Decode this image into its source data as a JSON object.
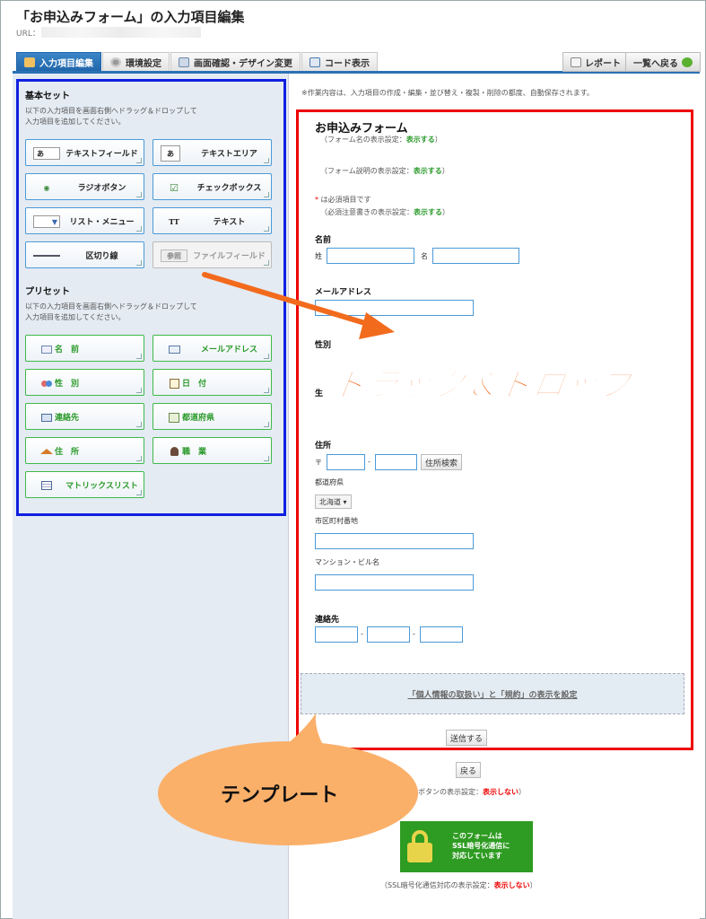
{
  "header": {
    "title": "「お申込みフォーム」の入力項目編集",
    "url_label": "URL："
  },
  "tabs": [
    {
      "label": "入力項目編集"
    },
    {
      "label": "環境設定"
    },
    {
      "label": "画面確認・デザイン変更"
    },
    {
      "label": "コード表示"
    }
  ],
  "toolbar": {
    "report": "レポート",
    "back_to_list": "一覧へ戻る"
  },
  "basic_set": {
    "title": "基本セット",
    "desc1": "以下の入力項目を画面右側へドラッグ＆ドロップして",
    "desc2": "入力項目を追加してください。",
    "items": [
      {
        "label": "テキストフィールド",
        "icon": "あ"
      },
      {
        "label": "テキストエリア",
        "icon": "あ"
      },
      {
        "label": "ラジオボタン",
        "icon": "◉"
      },
      {
        "label": "チェックボックス",
        "icon": "☑"
      },
      {
        "label": "リスト・メニュー",
        "icon": "▼"
      },
      {
        "label": "テキスト",
        "icon": "TT"
      },
      {
        "label": "区切り線",
        "icon": "—"
      },
      {
        "label": "ファイルフィールド",
        "icon": "参照"
      }
    ]
  },
  "preset": {
    "title": "プリセット",
    "desc1": "以下の入力項目を画面右側へドラッグ＆ドロップして",
    "desc2": "入力項目を追加してください。",
    "items": [
      {
        "label": "名　前"
      },
      {
        "label": "メールアドレス"
      },
      {
        "label": "性　別"
      },
      {
        "label": "日　付"
      },
      {
        "label": "連絡先"
      },
      {
        "label": "都道府県"
      },
      {
        "label": "住　所"
      },
      {
        "label": "職　業"
      },
      {
        "label": "マトリックスリスト"
      }
    ]
  },
  "autosave_note": "※作業内容は、入力項目の作成・編集・並び替え・複製・削除の都度、自動保存されます。",
  "form": {
    "title": "お申込みフォーム",
    "title_setting": "（フォーム名の表示設定：",
    "desc_setting": "（フォーム説明の表示設定：",
    "show": "表示する",
    "close_paren": "）",
    "required_mark": "*",
    "required_note": "は必須項目です",
    "required_setting": "（必須注意書きの表示設定：",
    "name_label": "名前",
    "sei": "姓",
    "mei": "名",
    "email_label": "メールアドレス",
    "gender_label": "性別",
    "birth_partial": "生",
    "address_label": "住所",
    "postal_mark": "〒",
    "dash": "-",
    "address_search": "住所検索",
    "pref_label": "都道府県",
    "pref_value": "北海道",
    "city_label": "市区町村番地",
    "building_label": "マンション・ビル名",
    "contact_label": "連絡先",
    "terms_link": "「個人情報の取扱い」と「規約」の表示を設定",
    "submit": "送信する",
    "back": "戻る",
    "back_setting": "ボタンの表示設定：",
    "hide": "表示しない",
    "ssl_line1": "このフォームは",
    "ssl_line2": "SSL暗号化通信に",
    "ssl_line3": "対応しています",
    "ssl_setting": "（SSL暗号化通信対応の表示設定："
  },
  "annotations": {
    "drag_drop": "ドラック＆ドロップ",
    "template": "テンプレート"
  },
  "colors": {
    "accent_blue": "#2a71b5",
    "box_blue": "#1020e0",
    "box_red": "#e00000",
    "orange": "#f26b1d",
    "bubble": "#fbb06a",
    "ssl_green": "#2e9b22"
  }
}
